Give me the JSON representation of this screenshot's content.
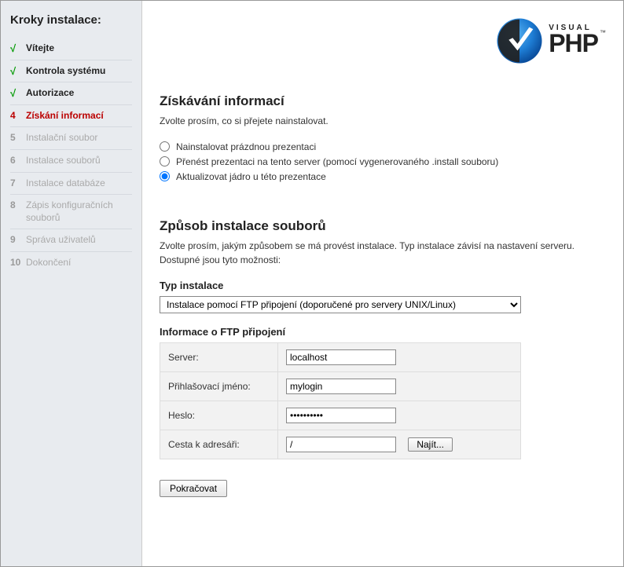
{
  "sidebar": {
    "title": "Kroky instalace:",
    "steps": [
      {
        "num": "√",
        "label": "Vítejte",
        "state": "done"
      },
      {
        "num": "√",
        "label": "Kontrola systému",
        "state": "done"
      },
      {
        "num": "√",
        "label": "Autorizace",
        "state": "done"
      },
      {
        "num": "4",
        "label": "Získání informací",
        "state": "active"
      },
      {
        "num": "5",
        "label": "Instalační soubor",
        "state": "future"
      },
      {
        "num": "6",
        "label": "Instalace souborů",
        "state": "future"
      },
      {
        "num": "7",
        "label": "Instalace databáze",
        "state": "future"
      },
      {
        "num": "8",
        "label": "Zápis konfiguračních souborů",
        "state": "future"
      },
      {
        "num": "9",
        "label": "Správa uživatelů",
        "state": "future"
      },
      {
        "num": "10",
        "label": "Dokončení",
        "state": "future"
      }
    ]
  },
  "logo": {
    "visual": "VISUAL",
    "php": "PHP",
    "tm": "™"
  },
  "info_section": {
    "heading": "Získávání informací",
    "desc": "Zvolte prosím, co si přejete nainstalovat.",
    "options": [
      {
        "label": "Nainstalovat prázdnou prezentaci",
        "checked": false
      },
      {
        "label": "Přenést prezentaci na tento server (pomocí vygenerovaného .install souboru)",
        "checked": false
      },
      {
        "label": "Aktualizovat jádro u této prezentace",
        "checked": true
      }
    ]
  },
  "install_section": {
    "heading": "Způsob instalace souborů",
    "desc": "Zvolte prosím, jakým způsobem se má provést instalace. Typ instalace závisí na nastavení serveru. Dostupné jsou tyto možnosti:",
    "type_label": "Typ instalace",
    "type_value": "Instalace pomocí FTP připojení (doporučené pro servery UNIX/Linux)",
    "ftp_heading": "Informace o FTP připojení",
    "fields": {
      "server_label": "Server:",
      "server_value": "localhost",
      "login_label": "Přihlašovací jméno:",
      "login_value": "mylogin",
      "password_label": "Heslo:",
      "password_value": "••••••••••",
      "path_label": "Cesta k adresáři:",
      "path_value": "/",
      "browse_label": "Najít..."
    }
  },
  "continue_label": "Pokračovat"
}
